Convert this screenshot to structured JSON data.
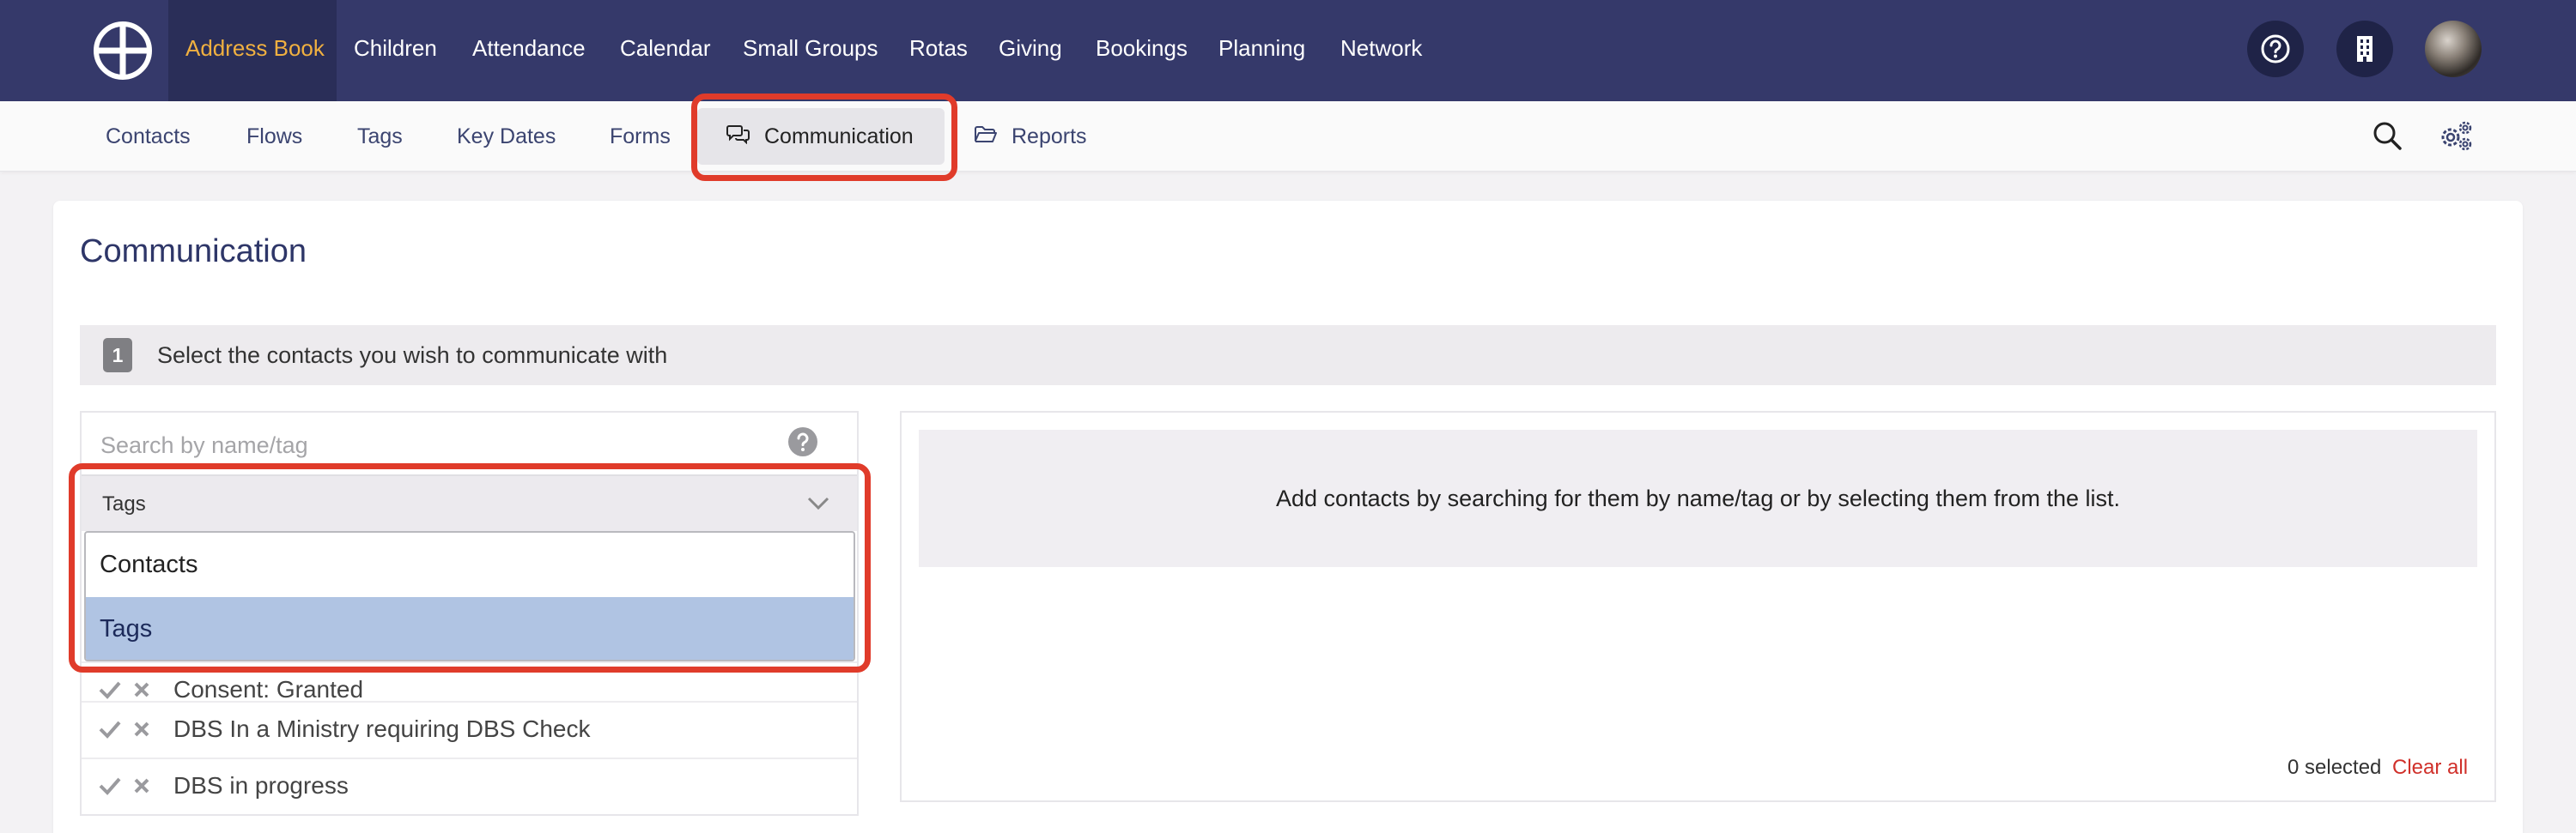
{
  "colors": {
    "topnav_bg": "#35396a",
    "topnav_active_bg": "#2a2e58",
    "topnav_active_text": "#f0b040",
    "highlight_border": "#e03b2a",
    "dropdown_selected_bg": "#b0c4e3",
    "clear_all": "#d0302a"
  },
  "topnav": {
    "logo_icon": "church-wheel-logo-icon",
    "items": [
      {
        "label": "Address Book",
        "active": true
      },
      {
        "label": "Children"
      },
      {
        "label": "Attendance"
      },
      {
        "label": "Calendar"
      },
      {
        "label": "Small Groups"
      },
      {
        "label": "Rotas"
      },
      {
        "label": "Giving"
      },
      {
        "label": "Bookings"
      },
      {
        "label": "Planning"
      },
      {
        "label": "Network"
      }
    ],
    "right_icons": [
      "help-icon",
      "building-icon",
      "avatar"
    ]
  },
  "subnav": {
    "items": [
      {
        "label": "Contacts"
      },
      {
        "label": "Flows"
      },
      {
        "label": "Tags"
      },
      {
        "label": "Key Dates"
      },
      {
        "label": "Forms"
      },
      {
        "label": "Communication",
        "active": true,
        "icon": "chat-bubbles-icon"
      },
      {
        "label": "Reports",
        "icon": "folder-open-icon"
      }
    ],
    "right_icons": [
      "search-icon",
      "settings-gears-icon"
    ]
  },
  "page": {
    "title": "Communication",
    "step": {
      "number": "1",
      "text": "Select the contacts you wish to communicate with"
    }
  },
  "left_panel": {
    "search_placeholder": "Search by name/tag",
    "filter_select": {
      "value": "Tags",
      "options": [
        {
          "label": "Contacts",
          "selected": false
        },
        {
          "label": "Tags",
          "selected": true
        }
      ]
    },
    "tags": [
      {
        "label": "Consent: Granted"
      },
      {
        "label": "DBS In a Ministry requiring DBS Check"
      },
      {
        "label": "DBS in progress"
      }
    ]
  },
  "right_panel": {
    "empty_message": "Add contacts by searching for them by name/tag or by selecting them from the list.",
    "selected_count": "0 selected",
    "clear_all": "Clear all"
  }
}
